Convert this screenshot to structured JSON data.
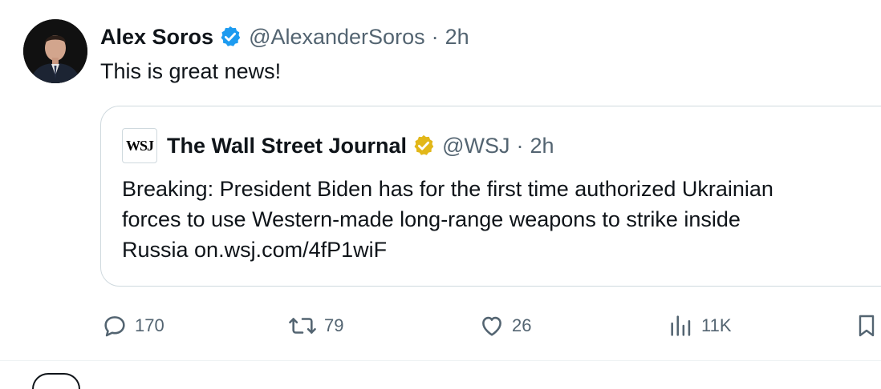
{
  "tweet": {
    "author_name": "Alex Soros",
    "handle": "@AlexanderSoros",
    "separator": "·",
    "time": "2h",
    "text": "This is great news!",
    "verified_color": "#1d9bf0"
  },
  "quote": {
    "logo_text": "WSJ",
    "author_name": "The Wall Street Journal",
    "handle": "@WSJ",
    "separator": "·",
    "time": "2h",
    "text": "Breaking: President Biden has for the first time authorized Ukrainian\nforces to use Western-made long-range weapons to strike inside\nRussia on.wsj.com/4fP1wiF",
    "verified_color": "#e2b719"
  },
  "actions": {
    "replies": "170",
    "reposts": "79",
    "likes": "26",
    "views": "11K"
  },
  "icons": [
    "verified-badge-icon",
    "gold-verified-badge-icon",
    "reply-icon",
    "repost-icon",
    "like-icon",
    "views-icon",
    "bookmark-icon"
  ]
}
